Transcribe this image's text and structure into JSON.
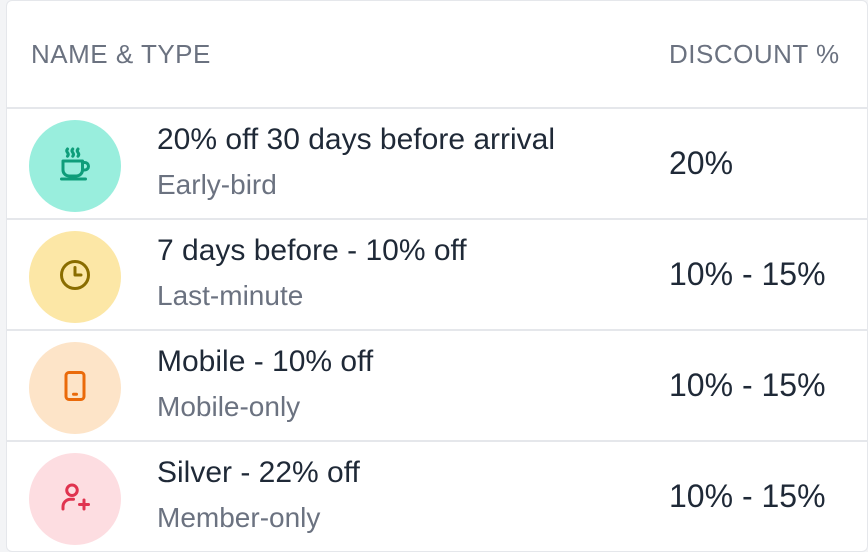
{
  "table": {
    "headers": {
      "name_type": "NAME & TYPE",
      "discount": "DISCOUNT %"
    },
    "rows": [
      {
        "name": "20% off 30 days before arrival",
        "type": "Early-bird",
        "discount": "20%",
        "icon": "coffee-cup-icon",
        "icon_bg": "#99eedd",
        "icon_color": "#0f9d7a"
      },
      {
        "name": "7 days before - 10% off",
        "type": "Last-minute",
        "discount": "10% - 15%",
        "icon": "clock-icon",
        "icon_bg": "#fce7a6",
        "icon_color": "#8a6d00"
      },
      {
        "name": "Mobile - 10% off",
        "type": "Mobile-only",
        "discount": "10% - 15%",
        "icon": "mobile-phone-icon",
        "icon_bg": "#fde4c8",
        "icon_color": "#ea6a0a"
      },
      {
        "name": "Silver - 22% off",
        "type": "Member-only",
        "discount": "10% - 15%",
        "icon": "add-user-icon",
        "icon_bg": "#fddde1",
        "icon_color": "#e0334f"
      }
    ]
  }
}
